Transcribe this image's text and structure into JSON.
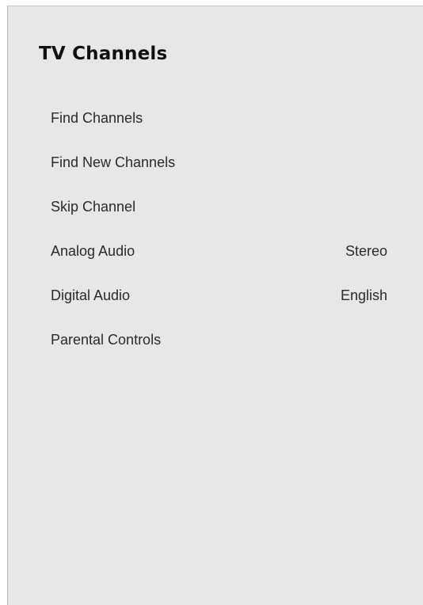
{
  "panel": {
    "title": "TV Channels"
  },
  "menu": {
    "items": [
      {
        "label": "Find Channels",
        "value": ""
      },
      {
        "label": "Find New Channels",
        "value": ""
      },
      {
        "label": "Skip Channel",
        "value": ""
      },
      {
        "label": "Analog Audio",
        "value": "Stereo"
      },
      {
        "label": "Digital Audio",
        "value": "English"
      },
      {
        "label": "Parental Controls",
        "value": ""
      }
    ]
  },
  "colors": {
    "panel_background": "#e7e7e7",
    "text": "#2a2a2a",
    "title": "#111111"
  }
}
